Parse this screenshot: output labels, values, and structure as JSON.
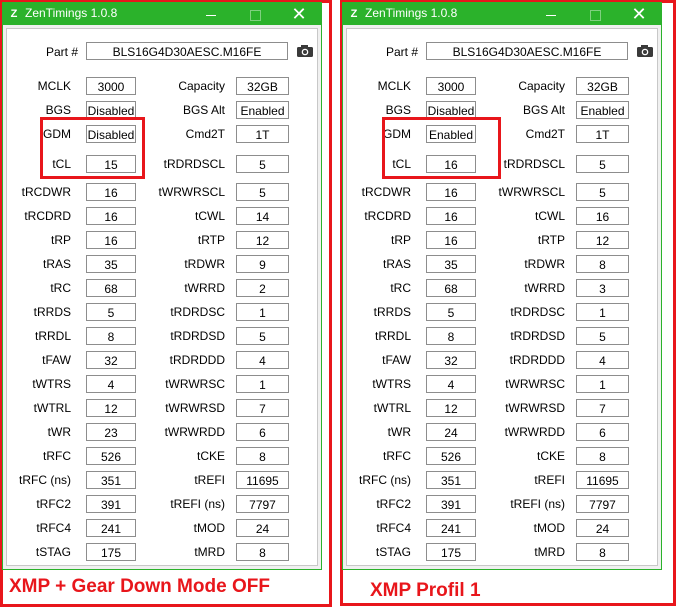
{
  "colors": {
    "accent": "#2bb22b",
    "highlight": "#e8161b"
  },
  "panels": [
    {
      "window_title": "ZenTimings 1.0.8",
      "part_label": "Part #",
      "part_value": "BLS16G4D30AESC.M16FE",
      "caption": "XMP + Gear Down Mode OFF",
      "left": [
        {
          "label": "MCLK",
          "value": "3000"
        },
        {
          "label": "BGS",
          "value": "Disabled"
        },
        {
          "label": "GDM",
          "value": "Disabled"
        },
        {
          "label": "tCL",
          "value": "15"
        },
        {
          "label": "tRCDWR",
          "value": "16"
        },
        {
          "label": "tRCDRD",
          "value": "16"
        },
        {
          "label": "tRP",
          "value": "16"
        },
        {
          "label": "tRAS",
          "value": "35"
        },
        {
          "label": "tRC",
          "value": "68"
        },
        {
          "label": "tRRDS",
          "value": "5"
        },
        {
          "label": "tRRDL",
          "value": "8"
        },
        {
          "label": "tFAW",
          "value": "32"
        },
        {
          "label": "tWTRS",
          "value": "4"
        },
        {
          "label": "tWTRL",
          "value": "12"
        },
        {
          "label": "tWR",
          "value": "23"
        },
        {
          "label": "tRFC",
          "value": "526"
        },
        {
          "label": "tRFC (ns)",
          "value": "351"
        },
        {
          "label": "tRFC2",
          "value": "391"
        },
        {
          "label": "tRFC4",
          "value": "241"
        },
        {
          "label": "tSTAG",
          "value": "175"
        }
      ],
      "right": [
        {
          "label": "Capacity",
          "value": "32GB"
        },
        {
          "label": "BGS Alt",
          "value": "Enabled"
        },
        {
          "label": "Cmd2T",
          "value": "1T"
        },
        {
          "label": "tRDRDSCL",
          "value": "5"
        },
        {
          "label": "tWRWRSCL",
          "value": "5"
        },
        {
          "label": "tCWL",
          "value": "14"
        },
        {
          "label": "tRTP",
          "value": "12"
        },
        {
          "label": "tRDWR",
          "value": "9"
        },
        {
          "label": "tWRRD",
          "value": "2"
        },
        {
          "label": "tRDRDSC",
          "value": "1"
        },
        {
          "label": "tRDRDSD",
          "value": "5"
        },
        {
          "label": "tRDRDDD",
          "value": "4"
        },
        {
          "label": "tWRWRSC",
          "value": "1"
        },
        {
          "label": "tWRWRSD",
          "value": "7"
        },
        {
          "label": "tWRWRDD",
          "value": "6"
        },
        {
          "label": "tCKE",
          "value": "8"
        },
        {
          "label": "tREFI",
          "value": "11695"
        },
        {
          "label": "tREFI (ns)",
          "value": "7797"
        },
        {
          "label": "tMOD",
          "value": "24"
        },
        {
          "label": "tMRD",
          "value": "8"
        }
      ]
    },
    {
      "window_title": "ZenTimings 1.0.8",
      "part_label": "Part #",
      "part_value": "BLS16G4D30AESC.M16FE",
      "caption": "XMP Profil 1",
      "left": [
        {
          "label": "MCLK",
          "value": "3000"
        },
        {
          "label": "BGS",
          "value": "Disabled"
        },
        {
          "label": "GDM",
          "value": "Enabled"
        },
        {
          "label": "tCL",
          "value": "16"
        },
        {
          "label": "tRCDWR",
          "value": "16"
        },
        {
          "label": "tRCDRD",
          "value": "16"
        },
        {
          "label": "tRP",
          "value": "16"
        },
        {
          "label": "tRAS",
          "value": "35"
        },
        {
          "label": "tRC",
          "value": "68"
        },
        {
          "label": "tRRDS",
          "value": "5"
        },
        {
          "label": "tRRDL",
          "value": "8"
        },
        {
          "label": "tFAW",
          "value": "32"
        },
        {
          "label": "tWTRS",
          "value": "4"
        },
        {
          "label": "tWTRL",
          "value": "12"
        },
        {
          "label": "tWR",
          "value": "24"
        },
        {
          "label": "tRFC",
          "value": "526"
        },
        {
          "label": "tRFC (ns)",
          "value": "351"
        },
        {
          "label": "tRFC2",
          "value": "391"
        },
        {
          "label": "tRFC4",
          "value": "241"
        },
        {
          "label": "tSTAG",
          "value": "175"
        }
      ],
      "right": [
        {
          "label": "Capacity",
          "value": "32GB"
        },
        {
          "label": "BGS Alt",
          "value": "Enabled"
        },
        {
          "label": "Cmd2T",
          "value": "1T"
        },
        {
          "label": "tRDRDSCL",
          "value": "5"
        },
        {
          "label": "tWRWRSCL",
          "value": "5"
        },
        {
          "label": "tCWL",
          "value": "16"
        },
        {
          "label": "tRTP",
          "value": "12"
        },
        {
          "label": "tRDWR",
          "value": "8"
        },
        {
          "label": "tWRRD",
          "value": "3"
        },
        {
          "label": "tRDRDSC",
          "value": "1"
        },
        {
          "label": "tRDRDSD",
          "value": "5"
        },
        {
          "label": "tRDRDDD",
          "value": "4"
        },
        {
          "label": "tWRWRSC",
          "value": "1"
        },
        {
          "label": "tWRWRSD",
          "value": "7"
        },
        {
          "label": "tWRWRDD",
          "value": "6"
        },
        {
          "label": "tCKE",
          "value": "8"
        },
        {
          "label": "tREFI",
          "value": "11695"
        },
        {
          "label": "tREFI (ns)",
          "value": "7797"
        },
        {
          "label": "tMOD",
          "value": "24"
        },
        {
          "label": "tMRD",
          "value": "8"
        }
      ]
    }
  ]
}
